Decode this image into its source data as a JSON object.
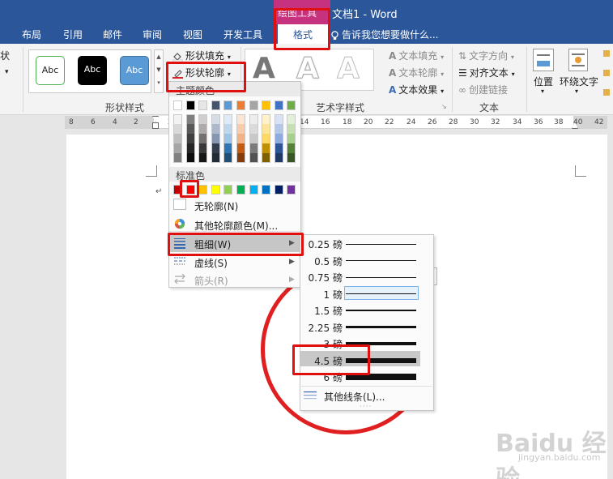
{
  "window": {
    "contextual_tool": "绘图工具",
    "title": "文档1 - Word"
  },
  "tabs": {
    "layout": "布局",
    "references": "引用",
    "mailings": "邮件",
    "review": "审阅",
    "view": "视图",
    "developer": "开发工具",
    "format": "格式",
    "tell_me": "告诉我您想要做什么..."
  },
  "ribbon": {
    "left_cut": "状",
    "style_samples": [
      "Abc",
      "Abc",
      "Abc"
    ],
    "shape_fill": "形状填充",
    "shape_outline": "形状轮廓",
    "shape_styles_label": "形状样式",
    "wordart_letters": [
      "A",
      "A",
      "A"
    ],
    "text_fill": "文本填充",
    "text_outline": "文本轮廓",
    "text_effects": "文本效果",
    "wordart_label": "艺术字样式",
    "text_direction": "文字方向",
    "align_text": "对齐文本",
    "create_link": "创建链接",
    "text_label": "文本",
    "position": "位置",
    "wrap_text": "环绕文字"
  },
  "ruler": {
    "ticks": [
      "8",
      "6",
      "4",
      "2",
      "2",
      "14",
      "16",
      "18",
      "20",
      "22",
      "24",
      "26",
      "28",
      "30",
      "32",
      "34",
      "36",
      "38",
      "40",
      "42"
    ]
  },
  "outline_menu": {
    "theme_colors_label": "主题颜色",
    "theme_top_row": [
      "#ffffff",
      "#000000",
      "#e7e6e6",
      "#44546a",
      "#5b9bd5",
      "#ed7d31",
      "#a5a5a5",
      "#ffc000",
      "#4472c4",
      "#70ad47"
    ],
    "theme_shades": [
      [
        "#f2f2f2",
        "#d9d9d9",
        "#bfbfbf",
        "#a6a6a6",
        "#808080"
      ],
      [
        "#7f7f7f",
        "#595959",
        "#404040",
        "#262626",
        "#0d0d0d"
      ],
      [
        "#d0cece",
        "#aeaaaa",
        "#757070",
        "#3a3838",
        "#171616"
      ],
      [
        "#d6dce4",
        "#adb9ca",
        "#8496b0",
        "#333f4f",
        "#222a35"
      ],
      [
        "#deebf6",
        "#bdd7ee",
        "#9dc3e6",
        "#2e75b5",
        "#1f4e79"
      ],
      [
        "#fbe5d5",
        "#f7cbac",
        "#f4b183",
        "#c55a11",
        "#843c0b"
      ],
      [
        "#ededed",
        "#dbdbdb",
        "#c9c9c9",
        "#7b7b7b",
        "#525252"
      ],
      [
        "#fff2cc",
        "#fee599",
        "#ffd965",
        "#bf9000",
        "#7f6000"
      ],
      [
        "#dae3f3",
        "#b4c7e7",
        "#8faadc",
        "#2f5496",
        "#203864"
      ],
      [
        "#e2efd9",
        "#c5e0b3",
        "#a8d08d",
        "#538135",
        "#375623"
      ]
    ],
    "standard_colors_label": "标准色",
    "standard_colors": [
      "#c00000",
      "#ff0000",
      "#ffc000",
      "#ffff00",
      "#92d050",
      "#00b050",
      "#00b0f0",
      "#0070c0",
      "#002060",
      "#7030a0"
    ],
    "no_outline": "无轮廓(N)",
    "more_colors": "其他轮廓颜色(M)...",
    "weight": "粗细(W)",
    "dashes": "虚线(S)",
    "arrows": "箭头(R)"
  },
  "weight_submenu": {
    "items": [
      {
        "label": "0.25 磅",
        "pt": 0.25
      },
      {
        "label": "0.5 磅",
        "pt": 0.5
      },
      {
        "label": "0.75 磅",
        "pt": 0.75
      },
      {
        "label": "1 磅",
        "pt": 1
      },
      {
        "label": "1.5 磅",
        "pt": 1.5
      },
      {
        "label": "2.25 磅",
        "pt": 2.25
      },
      {
        "label": "3 磅",
        "pt": 3
      },
      {
        "label": "4.5 磅",
        "pt": 4.5
      },
      {
        "label": "6 磅",
        "pt": 6
      }
    ],
    "current": "1 磅",
    "hovered": "4.5 磅",
    "more_lines": "其他线条(L)..."
  },
  "watermark": {
    "brand": "Baidu 经验",
    "site": "jingyan.baidu.com"
  }
}
